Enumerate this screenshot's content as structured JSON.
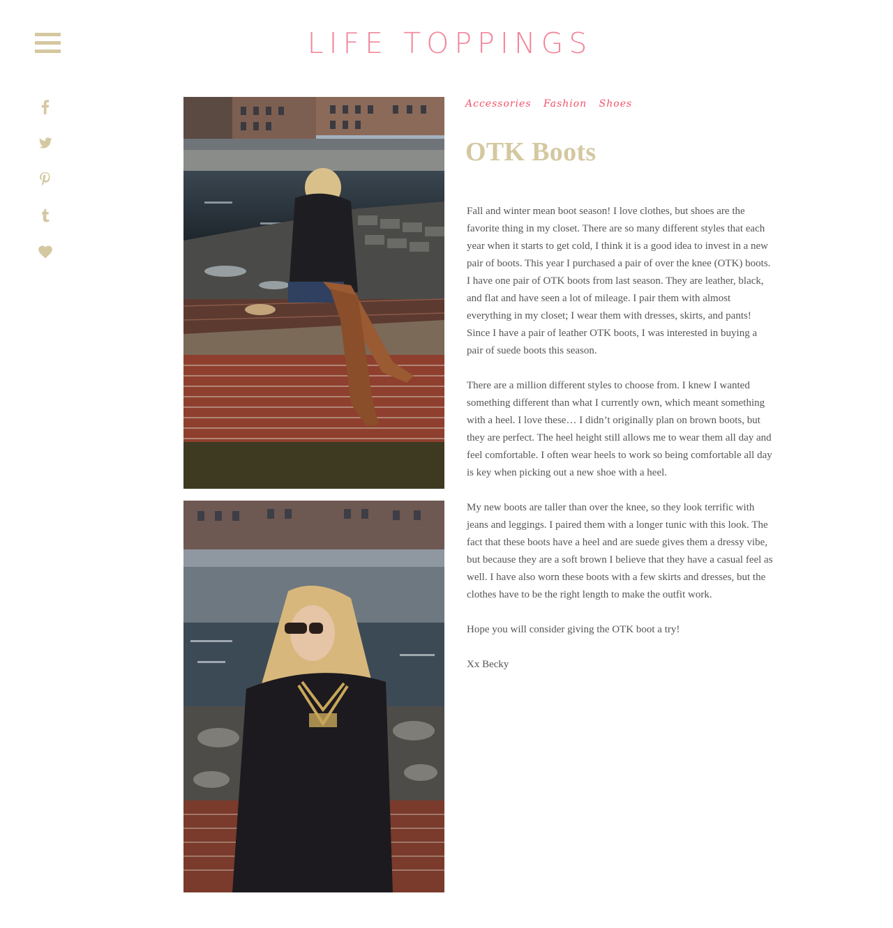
{
  "header": {
    "site_title": "LIFE TOPPINGS"
  },
  "social": {
    "icons": [
      "facebook-icon",
      "twitter-icon",
      "pinterest-icon",
      "tumblr-icon",
      "heart-icon"
    ]
  },
  "post": {
    "categories": [
      "Accessories",
      "Fashion",
      "Shoes"
    ],
    "title": "OTK Boots",
    "paragraphs": [
      "Fall and winter mean boot season! I love clothes, but shoes are the favorite thing in my closet. There are so many different styles that each year when it starts to get cold, I think it is a good idea to invest in a new pair of boots. This year I purchased a pair of over the knee (OTK) boots. I have one pair of OTK boots from last season. They are leather, black, and flat and have seen a lot of mileage. I pair them with almost everything in my closet; I wear them with dresses, skirts, and pants! Since I have a pair of leather OTK boots, I was interested in buying a pair of suede boots this season.",
      "There are a million different styles to choose from. I knew I wanted something different than what I currently own, which meant something with a heel. I love these… I didn’t originally plan on brown boots, but they are perfect. The heel height still allows me to wear them all day and feel comfortable. I often wear heels to work so being comfortable all day is key when picking out a new shoe with a heel.",
      "My new boots are taller than over the knee, so they look terrific with jeans and leggings. I paired them with a longer tunic with this look. The fact that these boots have a heel and are suede gives them a dressy vibe, but because they are a soft brown I believe that they have a casual feel as well. I have also worn these boots with a few skirts and dresses, but the clothes have to be the right length to make the outfit work.",
      "Hope you will consider giving the OTK boot a try!",
      "Xx Becky"
    ]
  },
  "colors": {
    "brand_pink": "#f2869a",
    "category_pink": "#f2506a",
    "gold": "#d4c8a0",
    "body_text": "#555555"
  }
}
